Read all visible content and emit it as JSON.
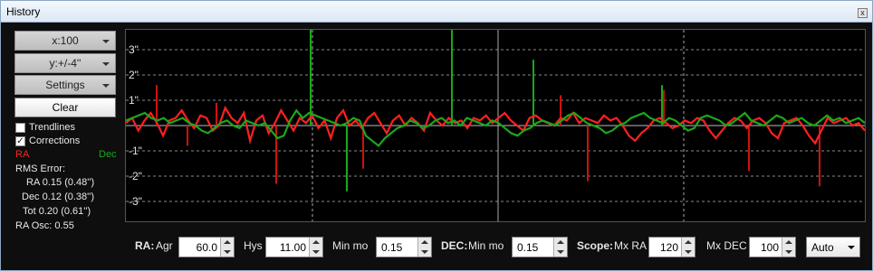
{
  "window": {
    "title": "History",
    "close_glyph": "x"
  },
  "controls": {
    "x_scale": "x:100",
    "y_scale": "y:+/-4''",
    "settings": "Settings",
    "clear": "Clear",
    "trendlines": {
      "label": "Trendlines",
      "checked": false
    },
    "corrections": {
      "label": "Corrections",
      "checked": true
    }
  },
  "legend": {
    "ra": "RA",
    "dec": "Dec",
    "ra_color": "#ff2020",
    "dec_color": "#1aa81a"
  },
  "rms": {
    "heading": "RMS Error:",
    "ra": "RA 0.15 (0.48'')",
    "dec": "Dec 0.12 (0.38'')",
    "tot": "Tot 0.20 (0.61'')",
    "ra_osc": "RA Osc: 0.55"
  },
  "bottom": {
    "ra_label": "RA:",
    "agr_label": "Agr",
    "agr_value": "60.0",
    "hys_label": "Hys",
    "hys_value": "11.00",
    "ra_minmo_label": "Min mo",
    "ra_minmo_value": "0.15",
    "dec_label": "DEC:",
    "dec_minmo_label": "Min mo",
    "dec_minmo_value": "0.15",
    "scope_label": "Scope:",
    "mxra_label": "Mx RA",
    "mxra_value": "120",
    "mxdec_label": "Mx DEC",
    "mxdec_value": "100",
    "auto_value": "Auto"
  },
  "chart_data": {
    "type": "line",
    "ylabels": [
      "3\"",
      "2\"",
      "1\"",
      "-1\"",
      "-2\"",
      "-3\""
    ],
    "ylim": [
      -4,
      4
    ],
    "grid": true,
    "series": [
      {
        "name": "RA",
        "color": "#ff2020",
        "values": [
          0.1,
          0.3,
          -0.2,
          0.2,
          0.5,
          0.1,
          -0.4,
          0.2,
          0.3,
          0.6,
          0.2,
          -0.1,
          0.4,
          0.3,
          -0.2,
          0.0,
          0.7,
          0.3,
          0.1,
          0.5,
          -0.6,
          0.2,
          0.4,
          -0.3,
          0.1,
          0.6,
          0.2,
          -0.2,
          0.3,
          0.1,
          0.4,
          -0.1,
          0.2,
          -0.5,
          0.3,
          0.6,
          0.0,
          0.2,
          -0.1,
          0.3,
          0.5,
          0.1,
          -0.3,
          0.2,
          0.4,
          0.0,
          0.3,
          0.1,
          -0.2,
          0.5,
          0.2,
          0.0,
          0.3,
          0.1,
          0.2,
          -0.1,
          0.3,
          0.2,
          0.4,
          0.1,
          0.3,
          0.5,
          0.2,
          0.0,
          -0.2,
          0.3,
          0.4,
          0.2,
          0.1,
          0.0,
          0.3,
          0.2,
          0.5,
          0.1,
          0.3,
          0.2,
          0.1,
          0.4,
          0.2,
          0.3,
          0.0,
          -0.4,
          -0.6,
          -0.3,
          -0.1,
          0.2,
          0.3,
          0.1,
          -0.1,
          0.0,
          0.2,
          0.1,
          0.3,
          0.2,
          -0.2,
          -0.5,
          -0.2,
          0.1,
          0.3,
          0.2,
          -0.1,
          0.2,
          0.3,
          0.1,
          -0.3,
          -0.5,
          0.1,
          0.2,
          0.3,
          0.0,
          -0.4,
          -0.7,
          -0.2,
          0.3,
          0.1,
          0.2,
          0.3,
          0.0,
          0.1,
          -0.2
        ]
      },
      {
        "name": "Dec",
        "color": "#1aa81a",
        "values": [
          0.2,
          0.3,
          0.4,
          0.5,
          0.3,
          0.2,
          0.3,
          0.1,
          0.2,
          0.3,
          0.1,
          0.0,
          -0.2,
          -0.3,
          -0.1,
          0.1,
          0.2,
          0.0,
          -0.1,
          0.2,
          0.1,
          0.0,
          0.1,
          -0.2,
          -0.5,
          -0.4,
          0.2,
          0.6,
          0.3,
          0.5,
          0.4,
          0.3,
          0.2,
          0.1,
          0.0,
          0.1,
          0.3,
          0.2,
          -0.4,
          -0.6,
          -0.8,
          -0.5,
          -0.3,
          -0.1,
          0.0,
          0.2,
          0.1,
          -0.1,
          0.0,
          0.2,
          0.3,
          0.1,
          0.2,
          0.0,
          0.3,
          0.2,
          0.1,
          0.0,
          0.2,
          0.1,
          -0.1,
          -0.3,
          -0.4,
          -0.2,
          -0.1,
          0.1,
          0.2,
          0.1,
          0.0,
          0.2,
          0.4,
          0.5,
          0.3,
          0.1,
          0.0,
          -0.1,
          -0.3,
          -0.2,
          0.0,
          0.1,
          0.3,
          0.4,
          0.5,
          0.3,
          0.2,
          0.1,
          0.3,
          0.2,
          0.0,
          -0.2,
          -0.1,
          0.3,
          0.4,
          0.3,
          0.2,
          0.0,
          0.1,
          0.3,
          0.5,
          0.2,
          0.1,
          0.0,
          0.2,
          0.4,
          0.3,
          0.1,
          0.2,
          0.3,
          0.1,
          0.0,
          0.2,
          0.4,
          0.2,
          0.3,
          0.1,
          0.2,
          0.3,
          0.1
        ]
      }
    ]
  }
}
